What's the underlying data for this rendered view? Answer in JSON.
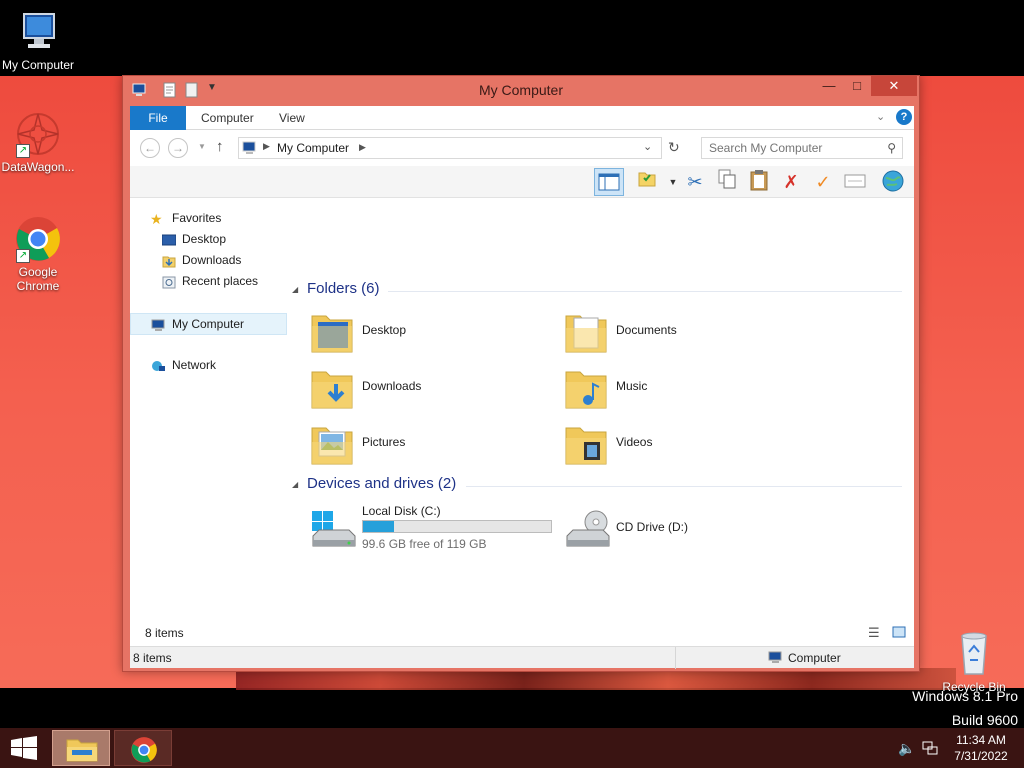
{
  "desktop": {
    "icons": [
      {
        "label": "My Computer"
      },
      {
        "label": "DataWagon..."
      },
      {
        "label": "Google Chrome"
      },
      {
        "label": "Recycle Bin"
      }
    ],
    "watermark_line1": "Windows 8.1 Pro",
    "watermark_line2": "Build 9600"
  },
  "window": {
    "title": "My Computer",
    "ribbon_tabs": [
      "File",
      "Computer",
      "View"
    ],
    "address": {
      "crumb": "My Computer"
    },
    "search": {
      "placeholder": "Search My Computer"
    },
    "nav_pane": {
      "favorites": "Favorites",
      "favorites_items": [
        "Desktop",
        "Downloads",
        "Recent places"
      ],
      "my_computer": "My Computer",
      "network": "Network"
    },
    "folders_header": "Folders (6)",
    "folders": [
      {
        "name": "Desktop",
        "icon": "desktop-folder-icon"
      },
      {
        "name": "Documents",
        "icon": "documents-folder-icon"
      },
      {
        "name": "Downloads",
        "icon": "downloads-folder-icon"
      },
      {
        "name": "Music",
        "icon": "music-folder-icon"
      },
      {
        "name": "Pictures",
        "icon": "pictures-folder-icon"
      },
      {
        "name": "Videos",
        "icon": "videos-folder-icon"
      }
    ],
    "devices_header": "Devices and drives (2)",
    "drives": [
      {
        "name": "Local Disk (C:)",
        "free": "99.6 GB free of 119 GB",
        "used_fraction": 0.163
      },
      {
        "name": "CD Drive (D:)"
      }
    ],
    "item_count": "8 items",
    "status_left": "8 items",
    "status_right": "Computer"
  },
  "taskbar": {
    "time": "11:34 AM",
    "date": "7/31/2022"
  },
  "colors": {
    "accent": "#1979ca",
    "group_header": "#1e3287",
    "drive_bar": "#26a0da",
    "window_frame": "#e67465"
  }
}
